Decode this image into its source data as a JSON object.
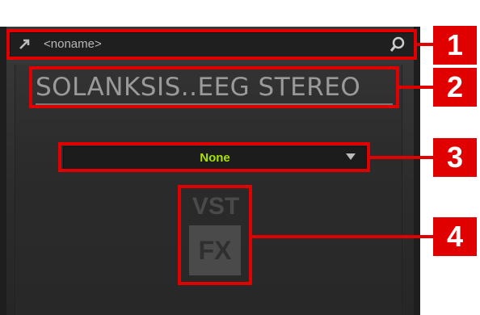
{
  "header": {
    "preset_name": "<noname>",
    "link_icon": "arrow-icon",
    "search_icon": "search-icon"
  },
  "plugin": {
    "title": "SOLANKSIS..EEG STEREO",
    "preset_dropdown_value": "None",
    "logo_top": "VST",
    "logo_bottom": "FX"
  },
  "callouts": [
    "1",
    "2",
    "3",
    "4"
  ],
  "colors": {
    "callout_red": "#e00000",
    "dropdown_text": "#a8e000",
    "panel_bg": "#2c2c2c"
  }
}
